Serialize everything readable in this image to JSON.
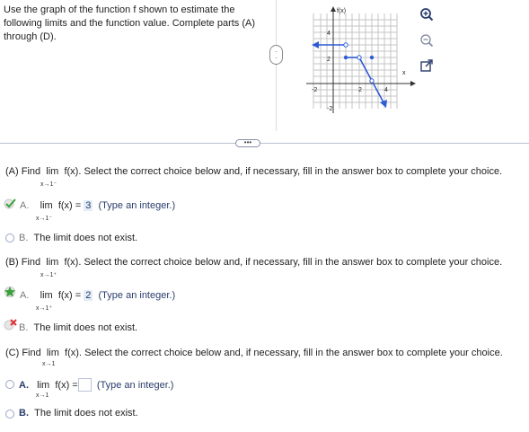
{
  "intro": "Use the graph of the function f shown to estimate the following limits and the function value. Complete parts (A) through (D).",
  "graph": {
    "fx_label": "f(x)",
    "x_label": "x",
    "x_ticks": [
      "-2",
      "2",
      "4"
    ],
    "y_ticks": [
      "4",
      "2",
      "-2"
    ]
  },
  "tools": {
    "zoom_in": "zoom-in",
    "zoom_out": "zoom-out",
    "popout": "pop-out"
  },
  "handles": {
    "vertical": "⋮",
    "horizontal": "•••"
  },
  "partA": {
    "prefix": "(A) Find",
    "lim": "lim",
    "func": "f(x).",
    "instruction": "Select the correct choice below and, if necessary, fill in the answer box to complete your choice.",
    "sub": "x→1⁻",
    "optA": {
      "letter": "A.",
      "expr": "lim",
      "func": "f(x) =",
      "value": "3",
      "hint": "(Type an integer.)",
      "sub": "x→1⁻"
    },
    "optB": {
      "letter": "B.",
      "text": "The limit does not exist."
    }
  },
  "partB": {
    "prefix": "(B) Find",
    "lim": "lim",
    "func": "f(x).",
    "instruction": "Select the correct choice below and, if necessary, fill in the answer box to complete your choice.",
    "sub": "x→1⁺",
    "optA": {
      "letter": "A.",
      "expr": "lim",
      "func": "f(x) =",
      "value": "2",
      "hint": "(Type an integer.)",
      "sub": "x→1⁺"
    },
    "optB": {
      "letter": "B.",
      "text": "The limit does not exist."
    }
  },
  "partC": {
    "prefix": "(C) Find",
    "lim": "lim",
    "func": "f(x).",
    "instruction": "Select the correct choice below and, if necessary, fill in the answer box to complete your choice.",
    "sub": "x→1",
    "optA": {
      "letter": "A.",
      "expr": "lim",
      "func": "f(x) =",
      "hint": "(Type an integer.)",
      "sub": "x→1"
    },
    "optB": {
      "letter": "B.",
      "text": "The limit does not exist."
    }
  }
}
